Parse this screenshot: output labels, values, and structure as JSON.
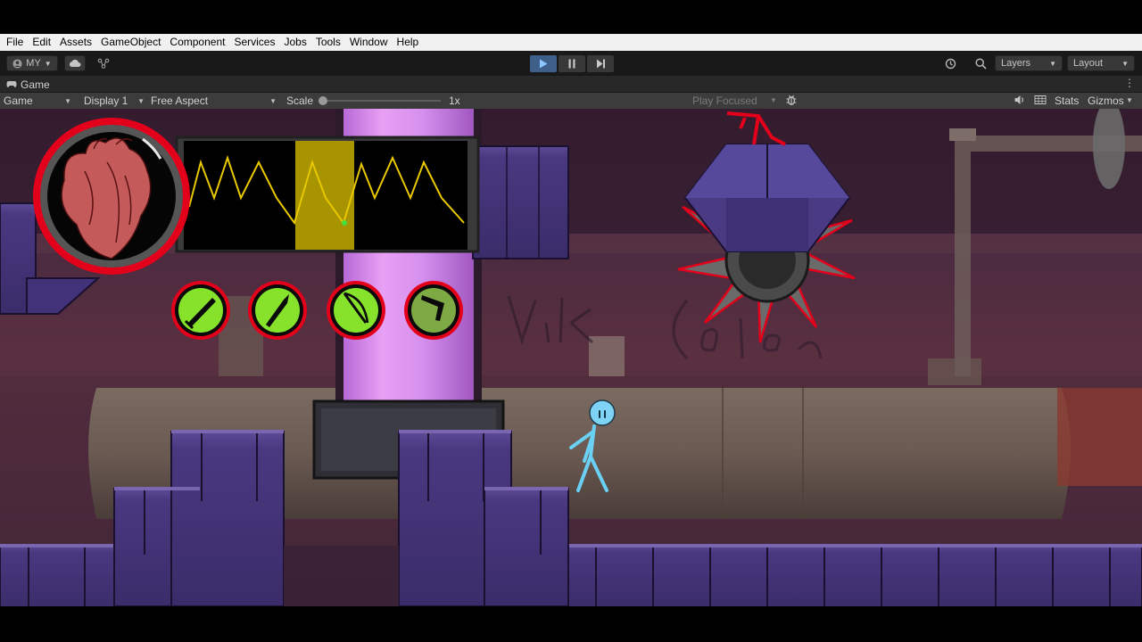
{
  "menu": [
    "File",
    "Edit",
    "Assets",
    "GameObject",
    "Component",
    "Services",
    "Jobs",
    "Tools",
    "Window",
    "Help"
  ],
  "toolbar": {
    "account": "MY",
    "layers": "Layers",
    "layout": "Layout",
    "play_state": "playing"
  },
  "tab": {
    "title": "Game"
  },
  "game_controls": {
    "view": "Game",
    "display": "Display 1",
    "aspect": "Free Aspect",
    "scale_label": "Scale",
    "scale_value": "1x",
    "play_focused": "Play Focused",
    "stats": "Stats",
    "gizmos": "Gizmos"
  },
  "hud": {
    "ability_icons": [
      "sword-icon",
      "dagger-icon",
      "bow-icon",
      "boomerang-icon"
    ],
    "accent": "#e2001a",
    "ability_color": "#86e22a"
  }
}
